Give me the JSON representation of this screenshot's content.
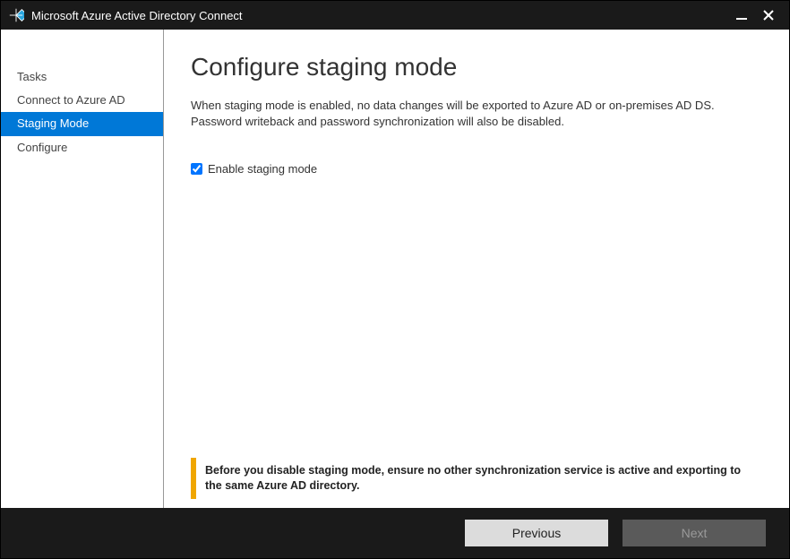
{
  "window": {
    "title": "Microsoft Azure Active Directory Connect"
  },
  "sidebar": {
    "items": [
      {
        "label": "Tasks",
        "active": false
      },
      {
        "label": "Connect to Azure AD",
        "active": false
      },
      {
        "label": "Staging Mode",
        "active": true
      },
      {
        "label": "Configure",
        "active": false
      }
    ]
  },
  "main": {
    "title": "Configure staging mode",
    "description": "When staging mode is enabled, no data changes will be exported to Azure AD or on-premises AD DS. Password writeback and password synchronization will also be disabled.",
    "checkbox": {
      "label": "Enable staging mode",
      "checked": true
    },
    "warning": "Before you disable staging mode, ensure no other synchronization service is active and exporting to the same Azure AD directory."
  },
  "footer": {
    "previous": "Previous",
    "next": "Next"
  }
}
